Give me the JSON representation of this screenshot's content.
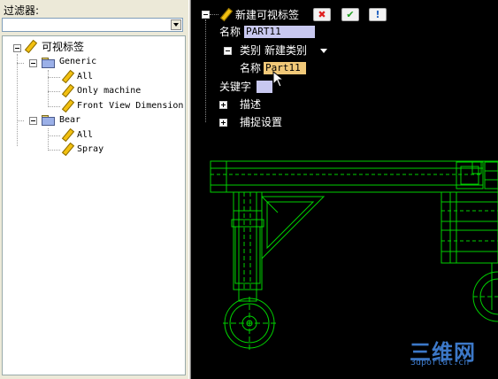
{
  "filter": {
    "label": "过滤器:",
    "value": ""
  },
  "tree": {
    "root": "可视标签",
    "groups": [
      {
        "name": "Generic",
        "items": [
          "All",
          "Only machine",
          "Front View Dimension"
        ]
      },
      {
        "name": "Bear",
        "items": [
          "All",
          "Spray"
        ]
      }
    ]
  },
  "editor": {
    "title": "新建可视标签",
    "name_label": "名称",
    "name_value": "PART11",
    "category_label": "类别",
    "category_value": "新建类别",
    "category_name_label": "名称",
    "category_name_value": "Part11",
    "keyword_label": "关键字",
    "keyword_value": "",
    "describe_label": "描述",
    "snap_label": "捕捉设置"
  },
  "watermark": {
    "logo": "三维网",
    "url": "3dportal.cn"
  },
  "colors": {
    "drawing": "#00d000",
    "field": "#c8c8f0",
    "field_active": "#f0c878",
    "watermark": "#3c78c8"
  }
}
